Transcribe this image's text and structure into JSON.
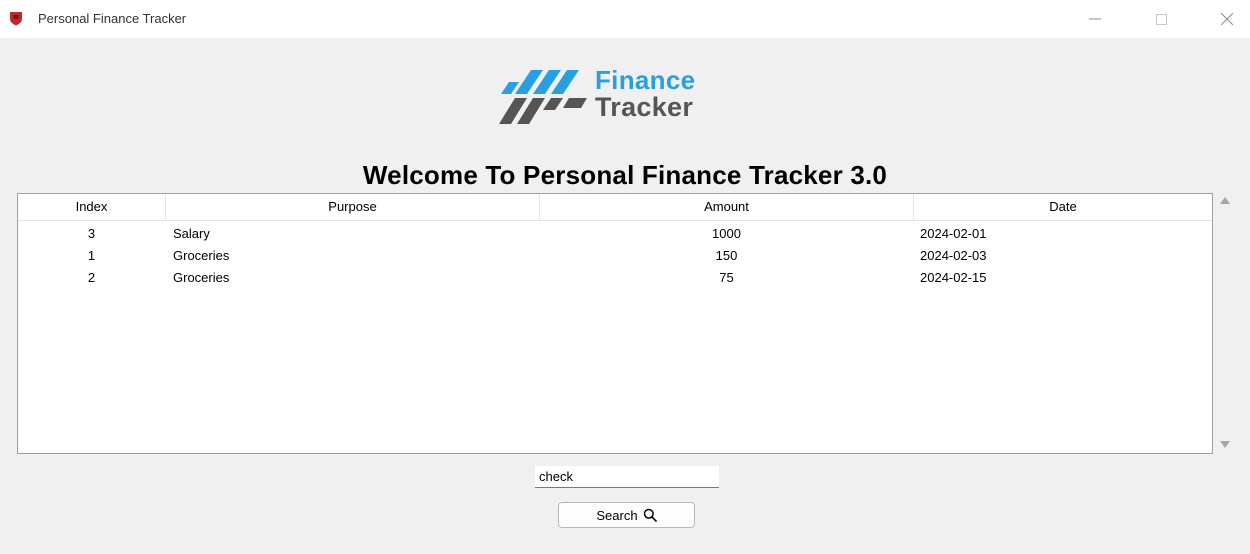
{
  "window": {
    "title": "Personal Finance Tracker"
  },
  "logo": {
    "line1": "Finance",
    "line2": "Tracker"
  },
  "heading": "Welcome To Personal Finance Tracker 3.0",
  "table": {
    "columns": [
      "Index",
      "Purpose",
      "Amount",
      "Date"
    ],
    "rows": [
      {
        "index": "3",
        "purpose": "Salary",
        "amount": "1000",
        "date": "2024-02-01"
      },
      {
        "index": "1",
        "purpose": "Groceries",
        "amount": "150",
        "date": "2024-02-03"
      },
      {
        "index": "2",
        "purpose": "Groceries",
        "amount": "75",
        "date": "2024-02-15"
      }
    ]
  },
  "search": {
    "value": "check",
    "button_label": "Search"
  },
  "colors": {
    "accent_blue": "#2a9fe0",
    "logo_gray": "#555555",
    "app_icon_red": "#c0262d"
  },
  "icons": {
    "app": "shield-icon",
    "search": "magnifier-icon",
    "minimize": "minimize-icon",
    "maximize": "maximize-icon",
    "close": "close-icon"
  }
}
